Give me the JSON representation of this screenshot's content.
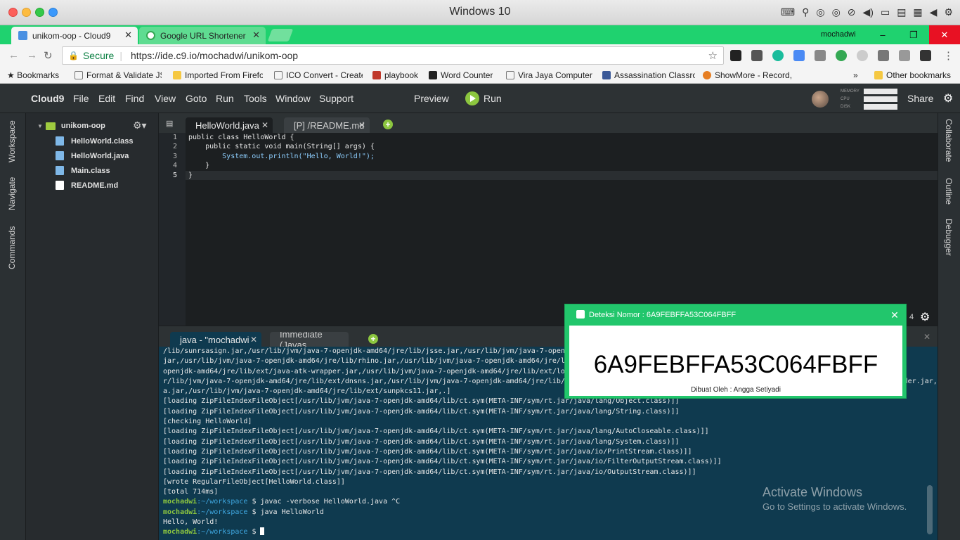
{
  "os": {
    "title": "Windows 10"
  },
  "browser": {
    "tabs": [
      {
        "label": "unikom-oop - Cloud9",
        "favicon_color": "#4a90e2"
      },
      {
        "label": "Google URL Shortener",
        "favicon_color": "#34a853"
      }
    ],
    "user": "mochadwi",
    "window_controls": {
      "minimize": "–",
      "restore": "❐",
      "close": "✕"
    },
    "secure_label": "Secure",
    "url": "https://ide.c9.io/mochadwi/unikom-oop",
    "bookmarks": [
      {
        "label": "Bookmarks",
        "icon": "star-icon"
      },
      {
        "label": "Format & Validate JS",
        "icon": "page-icon"
      },
      {
        "label": "Imported From Firefo",
        "icon": "folder-icon"
      },
      {
        "label": "ICO Convert - Create",
        "icon": "page-icon"
      },
      {
        "label": "playbook",
        "icon": "playbook-icon"
      },
      {
        "label": "Word Counter",
        "icon": "w-icon"
      },
      {
        "label": "Vira Jaya Computer (",
        "icon": "page-icon"
      },
      {
        "label": "Assassination Classro",
        "icon": "ac-icon"
      },
      {
        "label": "ShowMore - Record,",
        "icon": "showmore-icon"
      },
      {
        "label": "»",
        "icon": ""
      },
      {
        "label": "Other bookmarks",
        "icon": "folder-icon"
      }
    ]
  },
  "c9": {
    "brand": "Cloud9",
    "menu": [
      "File",
      "Edit",
      "Find",
      "View",
      "Goto",
      "Run",
      "Tools",
      "Window",
      "Support"
    ],
    "preview": "Preview",
    "run": "Run",
    "meters": [
      "MEMORY",
      "CPU",
      "DISK"
    ],
    "share": "Share",
    "left_tabs": [
      "Workspace",
      "Navigate",
      "Commands"
    ],
    "right_tabs": [
      "Collaborate",
      "Outline",
      "Debugger"
    ],
    "tree": {
      "root": "unikom-oop",
      "files": [
        "HelloWorld.class",
        "HelloWorld.java",
        "Main.class",
        "README.md"
      ]
    },
    "editor_tabs": [
      "HelloWorld.java",
      "[P] /README.md"
    ],
    "code_lines": [
      {
        "n": "1",
        "text": "public class HelloWorld {"
      },
      {
        "n": "2",
        "text": "    public static void main(String[] args) {"
      },
      {
        "n": "3",
        "text": "        System.out.println(\"Hello, World!\");"
      },
      {
        "n": "4",
        "text": "    }"
      },
      {
        "n": "5",
        "text": "}"
      }
    ],
    "status_num": "4",
    "terminal_tabs": [
      "java - \"mochadwi",
      "Immediate (Javas"
    ],
    "terminal_lines": [
      "/lib/sunrsasign.jar,/usr/lib/jvm/java-7-openjdk-amd64/jre/lib/jsse.jar,/usr/lib/jvm/java-7-openjdk-amd64/jre/lib/jce.jar,/usr/lib/jvm/java-7-openjdk-amd64/jre/lib/charsets.",
      "jar,/usr/lib/jvm/java-7-openjdk-amd64/jre/lib/rhino.jar,/usr/lib/jvm/java-7-openjdk-amd64/jre/lib/jfr.jar,/usr/lib/jvm/java-7-openjdk-amd64/jre/classes,/usr/lib/jvm/java-7-",
      "openjdk-amd64/jre/lib/ext/java-atk-wrapper.jar,/usr/lib/jvm/java-7-openjdk-amd64/jre/lib/ext/localedata.jar,/usr/lib/jvm/java-7-openjdk-amd64/jre/lib/ext/zipfs.jar,/us",
      "r/lib/jvm/java-7-openjdk-amd64/jre/lib/ext/dnsns.jar,/usr/lib/jvm/java-7-openjdk-amd64/jre/lib/ext/icedtea-sound.jar,/usr/lib/jvm/java-7-openjdk-amd64/jre/lib/ext/sunjce_provider.jar,dat",
      "a.jar,/usr/lib/jvm/java-7-openjdk-amd64/jre/lib/ext/sunpkcs11.jar,.]",
      "[loading ZipFileIndexFileObject[/usr/lib/jvm/java-7-openjdk-amd64/lib/ct.sym(META-INF/sym/rt.jar/java/lang/Object.class)]]",
      "[loading ZipFileIndexFileObject[/usr/lib/jvm/java-7-openjdk-amd64/lib/ct.sym(META-INF/sym/rt.jar/java/lang/String.class)]]",
      "[checking HelloWorld]",
      "[loading ZipFileIndexFileObject[/usr/lib/jvm/java-7-openjdk-amd64/lib/ct.sym(META-INF/sym/rt.jar/java/lang/AutoCloseable.class)]]",
      "[loading ZipFileIndexFileObject[/usr/lib/jvm/java-7-openjdk-amd64/lib/ct.sym(META-INF/sym/rt.jar/java/lang/System.class)]]",
      "[loading ZipFileIndexFileObject[/usr/lib/jvm/java-7-openjdk-amd64/lib/ct.sym(META-INF/sym/rt.jar/java/io/PrintStream.class)]]",
      "[loading ZipFileIndexFileObject[/usr/lib/jvm/java-7-openjdk-amd64/lib/ct.sym(META-INF/sym/rt.jar/java/io/FilterOutputStream.class)]]",
      "[loading ZipFileIndexFileObject[/usr/lib/jvm/java-7-openjdk-amd64/lib/ct.sym(META-INF/sym/rt.jar/java/io/OutputStream.class)]]",
      "[wrote RegularFileObject[HelloWorld.class]]",
      "[total 714ms]"
    ],
    "prompt": {
      "user": "mochadwi",
      "path": ":~/workspace",
      "sign": " $ "
    },
    "commands": [
      "javac -verbose HelloWorld.java ^C",
      "java HelloWorld"
    ],
    "output": "Hello, World!"
  },
  "watermark": {
    "line1": "Activate Windows",
    "line2": "Go to Settings to activate Windows."
  },
  "dialog": {
    "title": "Deteksi Nomor : 6A9FEBFFA53C064FBFF",
    "code": "6A9FEBFFA53C064FBFF",
    "credit": "Dibuat Oleh : Angga Setiyadi",
    "close": "✕"
  }
}
